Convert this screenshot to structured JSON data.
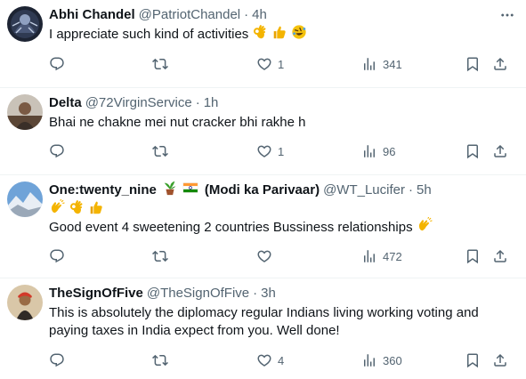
{
  "tweets": [
    {
      "name": "Abhi Chandel",
      "handle": "@PatriotChandel",
      "time": "4h",
      "text": "I appreciate such kind of activities",
      "reply_count": "",
      "retweet_count": "",
      "like_count": "1",
      "view_count": "341"
    },
    {
      "name": "Delta",
      "handle": "@72VirginService",
      "time": "1h",
      "text": "Bhai ne chakne mei nut cracker bhi rakhe h",
      "reply_count": "",
      "retweet_count": "",
      "like_count": "1",
      "view_count": "96"
    },
    {
      "name": "One:twenty_nine",
      "name_suffix": "(Modi ka Parivaar)",
      "handle": "@WT_Lucifer",
      "time": "5h",
      "text": "Good event 4 sweetening 2 countries Bussiness relationships",
      "reply_count": "",
      "retweet_count": "",
      "like_count": "",
      "view_count": "472"
    },
    {
      "name": "TheSignOfFive",
      "handle": "@TheSignOfFive",
      "time": "3h",
      "text_line1": "This is absolutely the diplomacy regular Indians living working voting and",
      "text_line2": "paying taxes in India expect from you. Well done!",
      "reply_count": "",
      "retweet_count": "",
      "like_count": "4",
      "view_count": "360"
    }
  ],
  "separator": "·",
  "icons": {
    "reply": "reply-icon",
    "retweet": "retweet-icon",
    "like": "like-icon",
    "views": "views-icon",
    "bookmark": "bookmark-icon",
    "share": "share-icon",
    "more": "more-icon"
  },
  "colors": {
    "text": "#0f1419",
    "muted": "#536471",
    "border": "#eff3f4"
  }
}
